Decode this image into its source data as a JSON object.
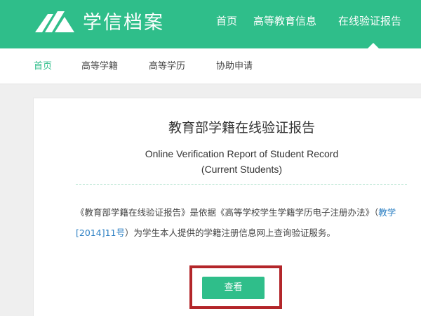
{
  "header": {
    "logo_text": "学信档案",
    "nav": [
      "首页",
      "高等教育信息",
      "在线验证报告"
    ]
  },
  "subnav": {
    "items": [
      "首页",
      "高等学籍",
      "高等学历",
      "协助申请"
    ]
  },
  "card": {
    "title_cn": "教育部学籍在线验证报告",
    "title_en_line1": "Online Verification Report of Student Record",
    "title_en_line2": "(Current Students)",
    "desc_part1": "《教育部学籍在线验证报告》是依据《高等学校学生学籍学历电子注册办法》（",
    "desc_link": "教学[2014]11号",
    "desc_part2": "）为学生本人提供的学籍注册信息网上查询验证服务。",
    "button_label": "查看"
  },
  "colors": {
    "brand": "#2fbe8a",
    "highlight_frame": "#b3262a",
    "link": "#2b7fc3"
  }
}
